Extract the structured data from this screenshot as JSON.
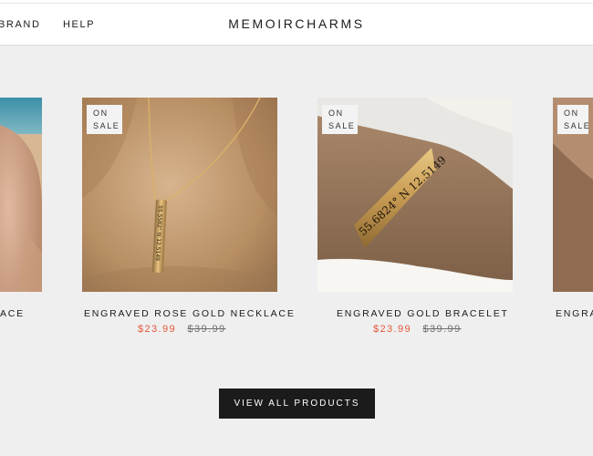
{
  "header": {
    "nav_left": [
      "BRAND",
      "HELP"
    ],
    "brand_name": "MEMOIRCHARMS"
  },
  "products": [
    {
      "title": "ACE",
      "price": "",
      "compare_price": ""
    },
    {
      "badge_line1": "ON",
      "badge_line2": "SALE",
      "title": "ENGRAVED ROSE GOLD NECKLACE",
      "price": "$23.99",
      "compare_price": "$39.99"
    },
    {
      "badge_line1": "ON",
      "badge_line2": "SALE",
      "title": "ENGRAVED GOLD BRACELET",
      "price": "$23.99",
      "compare_price": "$39.99"
    },
    {
      "badge_line1": "ON",
      "badge_line2": "SALE",
      "title": "ENGRA",
      "price": "",
      "compare_price": ""
    }
  ],
  "engraving_necklace": "55.5582° N 12.5149",
  "engraving_bracelet": "55.6824° N 12.5149",
  "cta": {
    "label": "VIEW ALL PRODUCTS"
  },
  "colors": {
    "sale_price": "#e3573a",
    "cta_bg": "#1c1b1b",
    "page_bg": "#efefef"
  }
}
